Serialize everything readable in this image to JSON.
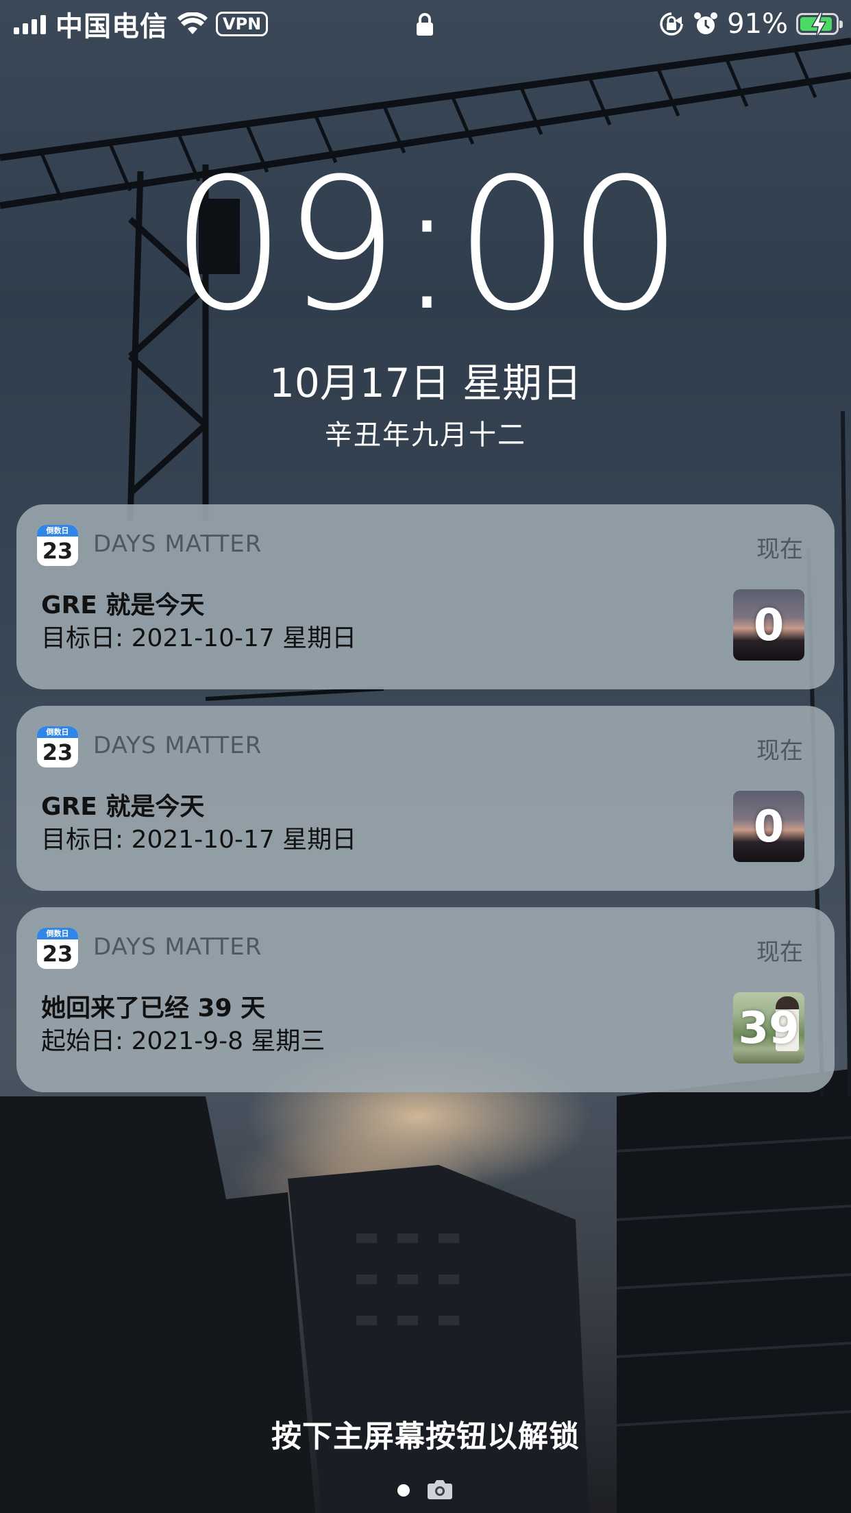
{
  "status_bar": {
    "carrier": "中国电信",
    "vpn_label": "VPN",
    "battery_percent": "91%",
    "battery_level": 0.91,
    "signal_bars": 4,
    "icons": [
      "signal-icon",
      "wifi-icon",
      "lock-icon",
      "rotation-lock-icon",
      "alarm-icon",
      "battery-charging-icon"
    ]
  },
  "lock_screen": {
    "time": "09:00",
    "date": "10月17日 星期日",
    "lunar_date": "辛丑年九月十二",
    "unlock_hint": "按下主屏幕按钮以解锁"
  },
  "notifications": [
    {
      "app_name": "DAYS MATTER",
      "app_icon_label": "倒数日",
      "app_icon_number": "23",
      "time": "现在",
      "title": "GRE 就是今天",
      "body": "目标日: 2021-10-17 星期日",
      "thumbnail_number": "0"
    },
    {
      "app_name": "DAYS MATTER",
      "app_icon_label": "倒数日",
      "app_icon_number": "23",
      "time": "现在",
      "title": "GRE 就是今天",
      "body": "目标日: 2021-10-17 星期日",
      "thumbnail_number": "0"
    },
    {
      "app_name": "DAYS MATTER",
      "app_icon_label": "倒数日",
      "app_icon_number": "23",
      "time": "现在",
      "title": "她回来了已经 39 天",
      "body": "起始日: 2021-9-8 星期三",
      "thumbnail_number": "39"
    }
  ],
  "colors": {
    "notification_bg": "#a0abb2",
    "battery_fill": "#4cd964",
    "app_icon_accent": "#2f86e6"
  }
}
